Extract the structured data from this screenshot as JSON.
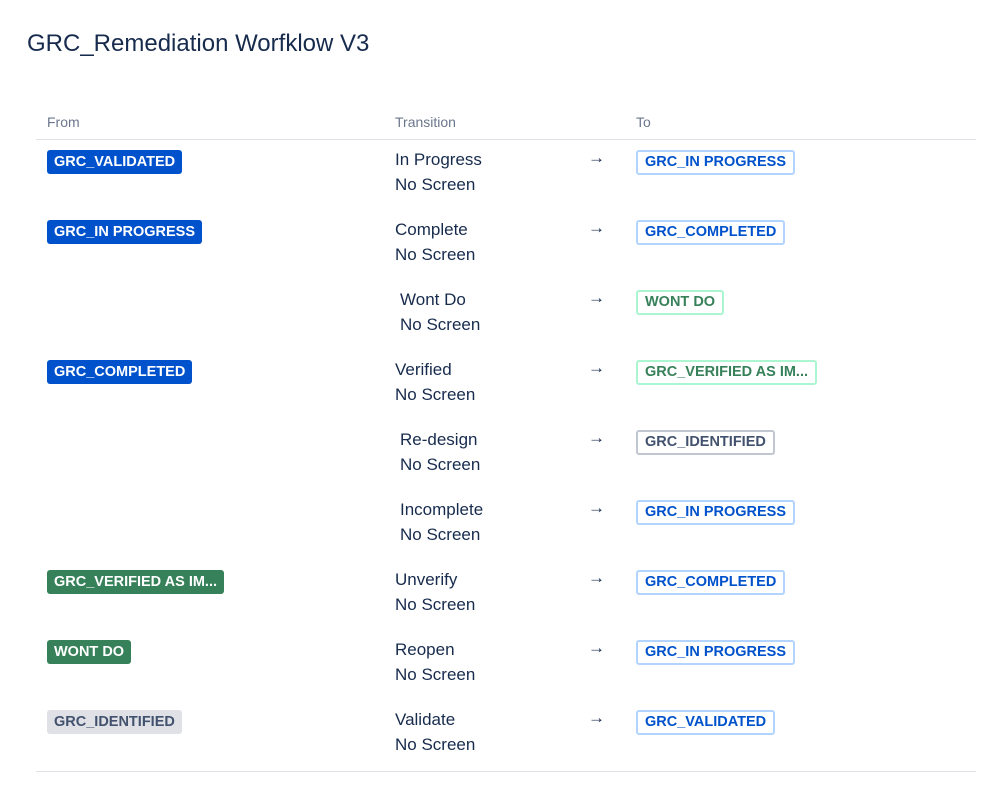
{
  "page": {
    "title": "GRC_Remediation Worfklow V3"
  },
  "headers": {
    "from": "From",
    "transition": "Transition",
    "to": "To"
  },
  "rows": [
    {
      "from": {
        "label": "GRC_VALIDATED",
        "color": "blue"
      },
      "transition": "In Progress",
      "screen": "No Screen",
      "arrow": "→",
      "to": {
        "label": "GRC_IN PROGRESS",
        "color": "blue"
      }
    },
    {
      "from": {
        "label": "GRC_IN PROGRESS",
        "color": "blue"
      },
      "transition": "Complete",
      "screen": "No Screen",
      "arrow": "→",
      "to": {
        "label": "GRC_COMPLETED",
        "color": "blue"
      }
    },
    {
      "from": null,
      "transition": "Wont Do",
      "screen": "No Screen",
      "arrow": "→",
      "to": {
        "label": "WONT DO",
        "color": "green"
      }
    },
    {
      "from": {
        "label": "GRC_COMPLETED",
        "color": "blue"
      },
      "transition": "Verified",
      "screen": "No Screen",
      "arrow": "→",
      "to": {
        "label": "GRC_VERIFIED AS IM...",
        "color": "green"
      }
    },
    {
      "from": null,
      "transition": "Re-design",
      "screen": "No Screen",
      "arrow": "→",
      "to": {
        "label": "GRC_IDENTIFIED",
        "color": "grey"
      }
    },
    {
      "from": null,
      "transition": "Incomplete",
      "screen": "No Screen",
      "arrow": "→",
      "to": {
        "label": "GRC_IN PROGRESS",
        "color": "blue"
      }
    },
    {
      "from": {
        "label": "GRC_VERIFIED AS IM...",
        "color": "green"
      },
      "transition": "Unverify",
      "screen": "No Screen",
      "arrow": "→",
      "to": {
        "label": "GRC_COMPLETED",
        "color": "blue"
      }
    },
    {
      "from": {
        "label": "WONT DO",
        "color": "green"
      },
      "transition": "Reopen",
      "screen": "No Screen",
      "arrow": "→",
      "to": {
        "label": "GRC_IN PROGRESS",
        "color": "blue"
      }
    },
    {
      "from": {
        "label": "GRC_IDENTIFIED",
        "color": "grey"
      },
      "transition": "Validate",
      "screen": "No Screen",
      "arrow": "→",
      "to": {
        "label": "GRC_VALIDATED",
        "color": "blue"
      }
    }
  ],
  "colors": {
    "blue_fill": "#0052cc",
    "green_fill": "#36815a",
    "grey_fill": "#dfe1e6",
    "text": "#172b4d",
    "header_text": "#6b778c",
    "divider": "#dfe1e6"
  }
}
